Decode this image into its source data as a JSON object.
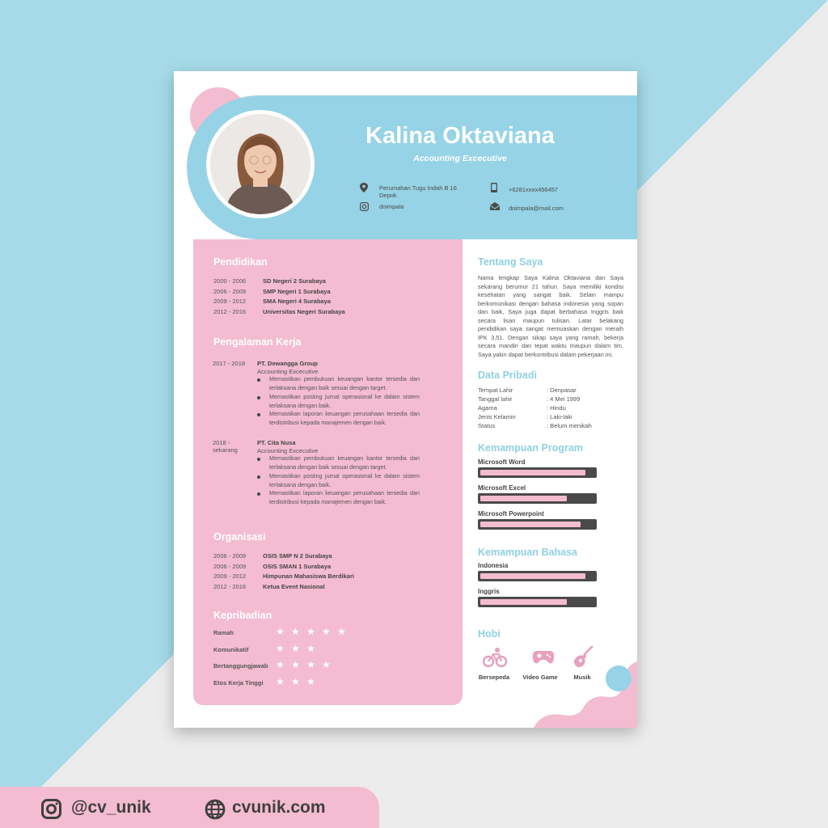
{
  "header": {
    "name": "Kalina Oktaviana",
    "job_title": "Accounting Excecutive",
    "address": "Perumahan Tugu Indah B 16 Depok",
    "phone": "+6281xxxx456457",
    "instagram": "doimpala",
    "email": "doimpala@mail.com"
  },
  "pendidikan": {
    "title": "Pendidikan",
    "items": [
      {
        "years": "2000 - 2006",
        "school": "SD Negeri 2 Surabaya"
      },
      {
        "years": "2006 - 2009",
        "school": "SMP Negeri 1 Surabaya"
      },
      {
        "years": "2009 - 2012",
        "school": "SMA Negeri 4 Surabaya"
      },
      {
        "years": "2012 - 2016",
        "school": "Universitas Negeri Surabaya"
      }
    ]
  },
  "pengalaman": {
    "title": "Pengalaman Kerja",
    "jobs": [
      {
        "years": "2017 - 2018",
        "company": "PT. Dewangga Group",
        "role": "Accounting Excecutive",
        "bullets": [
          "Memastikan pembukuan keuangan kantor tersedia dan terlaksana dengan baik sesuai dengan target.",
          "Memastikan posting jurnal operasional ke dalam sistem terlaksana dengan baik.",
          "Memastikan laporan keuangan perusahaan tersedia dan terdistribusi kepada manajemen dengan baik."
        ]
      },
      {
        "years_line1": "2018 -",
        "years_line2": "sekarang",
        "company": "PT. Cita Nusa",
        "role": "Accounting Excecutive",
        "bullets": [
          "Memastikan pembukuan keuangan kantor tersedia dan terlaksana dengan baik sesuai dengan target.",
          "Memastikan posting jurnal operasional ke dalam sistem terlaksana dengan baik.",
          "Memastikan laporan keuangan perusahaan tersedia dan terdistribusi kepada manajemen dengan baik."
        ]
      }
    ]
  },
  "organisasi": {
    "title": "Organisasi",
    "items": [
      {
        "years": "2006 - 2009",
        "org": "OSIS SMP N 2 Surabaya"
      },
      {
        "years": "2006 - 2009",
        "org": "OSIS SMAN 1 Surabaya"
      },
      {
        "years": "2009 - 2012",
        "org": "Himpunan Mahasiswa Berdikari"
      },
      {
        "years": "2012 - 2016",
        "org": "Ketua Event Nasional"
      }
    ]
  },
  "kepribadian": {
    "title": "Kepribadian",
    "items": [
      {
        "label": "Ramah",
        "stars": 5
      },
      {
        "label": "Komunikatif",
        "stars": 3
      },
      {
        "label": "Bertanggungjawab",
        "stars": 4
      },
      {
        "label": "Etos Kerja Tinggi",
        "stars": 3
      }
    ]
  },
  "tentang": {
    "title": "Tentang Saya",
    "text": "Nama lengkap Saya Kalina Oktaviana dan Saya sekarang berumur 21 tahun. Saya memiliki kondisi kesehatan yang sangat baik. Selain mampu berkomunikasi dengan bahasa indonesia yang sopan dan baik, Saya juga dapat berbahasa Inggris baik secara lisan maupun tulisan. Latar belakang pendidikan saya sangat memuaskan dengan meraih IPK 3,51. Dengan sikap saya yang ramah, bekerja secara mandiri dan tepat waktu maupun dalam tim, Saya yakin dapat berkontribusi dalam pekerjaan ini."
  },
  "pribadi": {
    "title": "Data Pribadi",
    "rows": [
      {
        "label": "Tempat Lahir",
        "value": ": Denpasar"
      },
      {
        "label": "Tanggal lahir",
        "value": ": 4 Mei 1999"
      },
      {
        "label": "Agama",
        "value": ": Hindu"
      },
      {
        "label": "Jenis Kelamin",
        "value": ": Laki-laki"
      },
      {
        "label": "Status",
        "value": ": Belum menikah"
      }
    ]
  },
  "program": {
    "title": "Kemampuan Program",
    "skills": [
      {
        "name": "Microsoft Word",
        "level": 0.92
      },
      {
        "name": "Microsoft Excel",
        "level": 0.76
      },
      {
        "name": "Microsoft Powerpoint",
        "level": 0.88
      }
    ]
  },
  "bahasa": {
    "title": "Kemampuan Bahasa",
    "skills": [
      {
        "name": "Indonesia",
        "level": 0.92
      },
      {
        "name": "Inggris",
        "level": 0.76
      }
    ]
  },
  "hobi": {
    "title": "Hobi",
    "items": [
      {
        "label": "Bersepeda",
        "icon": "bicycle-icon"
      },
      {
        "label": "Video Game",
        "icon": "gamepad-icon"
      },
      {
        "label": "Musik",
        "icon": "guitar-icon"
      }
    ]
  },
  "footer": {
    "instagram": "@cv_unik",
    "website": "cvunik.com"
  },
  "colors": {
    "pink": "#f4bcd1",
    "blue": "#96d3e6",
    "dark": "#4a4a4a"
  }
}
